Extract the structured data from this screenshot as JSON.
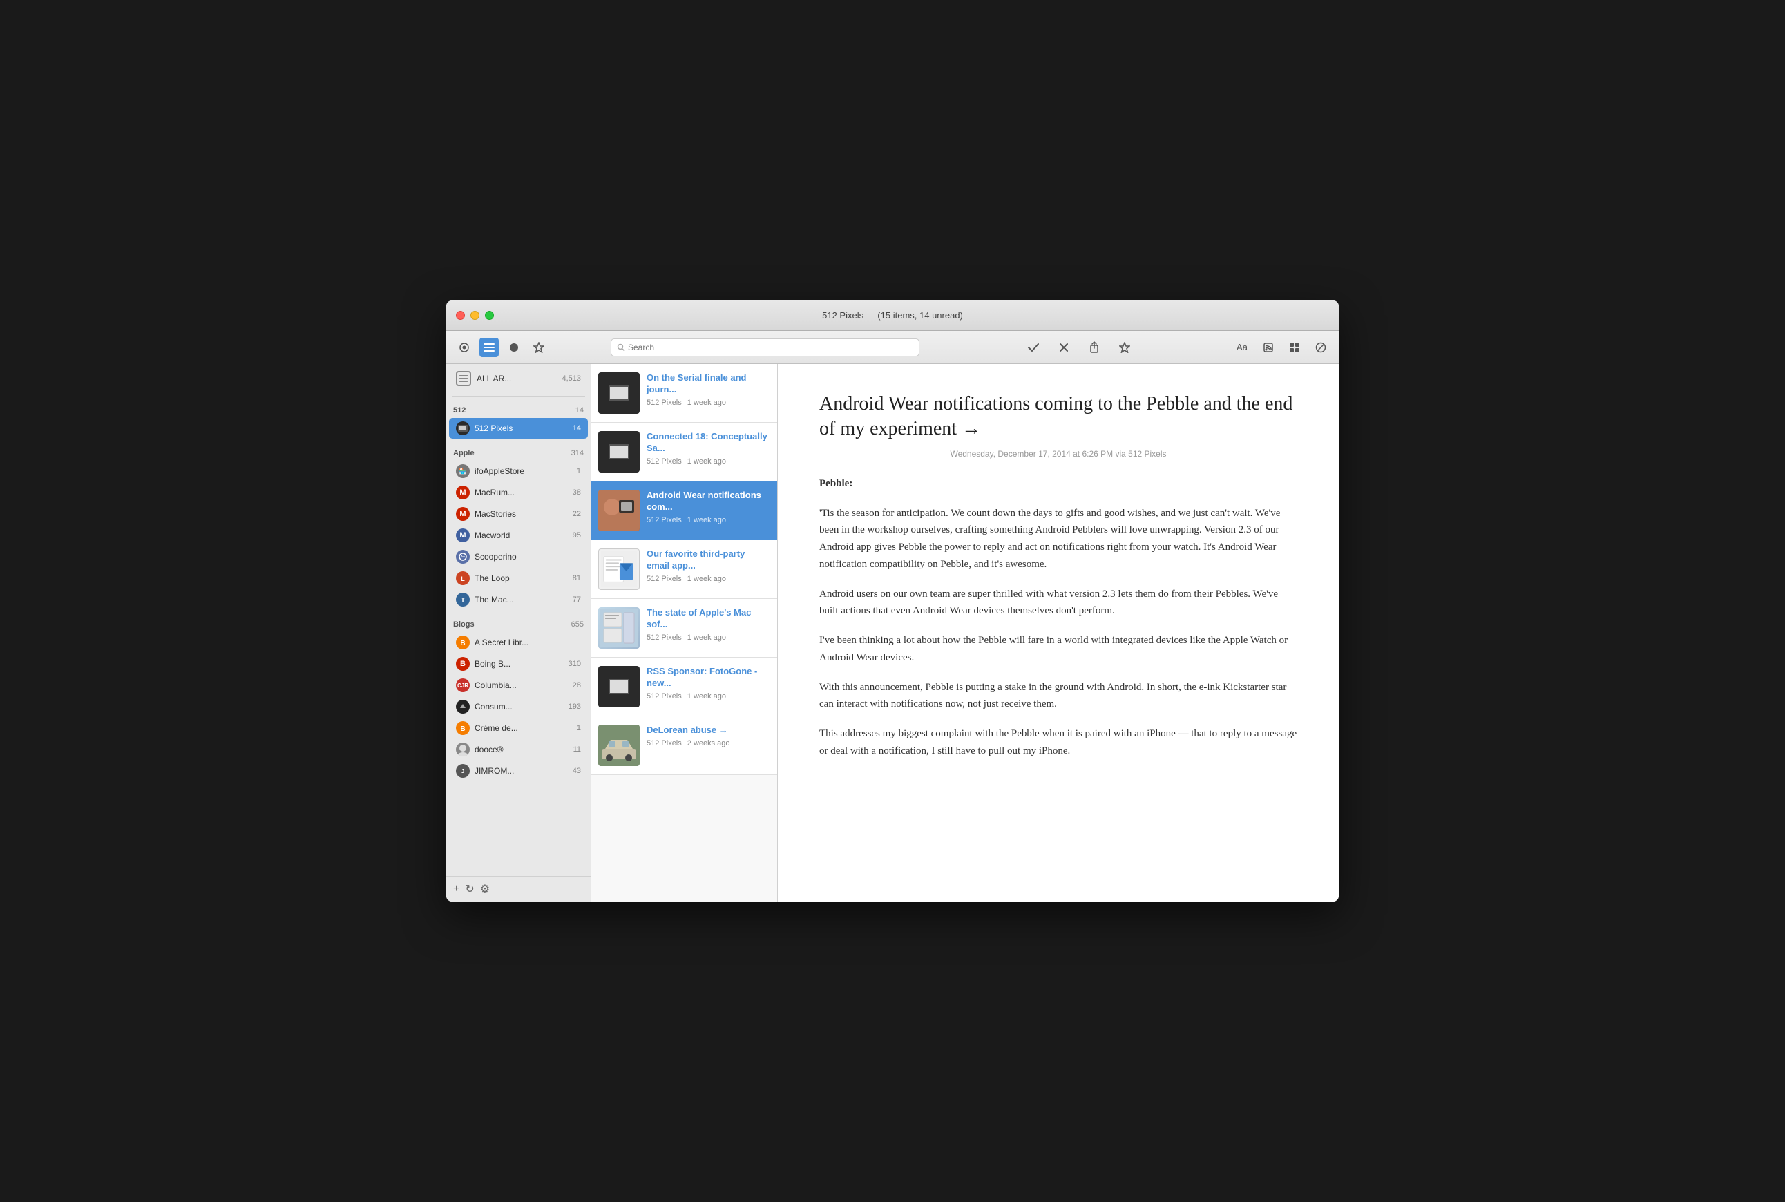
{
  "window": {
    "title": "512 Pixels — (15 items, 14 unread)"
  },
  "toolbar": {
    "search_placeholder": "Search",
    "mark_read_label": "✓",
    "close_label": "✕",
    "share_label": "⬆",
    "star_label": "☆",
    "font_label": "Aa",
    "rss_label": "RSS",
    "list_label": "≡",
    "block_label": "⊘"
  },
  "sidebar": {
    "all_articles_label": "ALL AR...",
    "all_articles_count": "4,513",
    "sections": [
      {
        "id": "512",
        "label": "512",
        "count": "14",
        "feeds": [
          {
            "id": "512pixels",
            "label": "512 Pixels",
            "count": "14",
            "active": true
          }
        ]
      },
      {
        "id": "apple",
        "label": "Apple",
        "count": "314",
        "feeds": [
          {
            "id": "ifoAppleStore",
            "label": "ifoAppleStore",
            "count": "1",
            "icon_color": "#888",
            "icon_char": "🏪"
          },
          {
            "id": "macrumors",
            "label": "MacRum...",
            "count": "38",
            "icon_color": "#cc2200",
            "icon_char": "M"
          },
          {
            "id": "macstories",
            "label": "MacStories",
            "count": "22",
            "icon_color": "#cc2200",
            "icon_char": "M"
          },
          {
            "id": "macworld",
            "label": "Macworld",
            "count": "95",
            "icon_color": "#4060a0",
            "icon_char": "M"
          },
          {
            "id": "scoopbox",
            "label": "Scooperino",
            "count": "",
            "icon_color": "#5a70a8",
            "icon_char": "S"
          },
          {
            "id": "theloop",
            "label": "The Loop",
            "count": "81",
            "icon_color": "#cc4422",
            "icon_char": "L"
          },
          {
            "id": "themac",
            "label": "The Mac...",
            "count": "77",
            "icon_color": "#336699",
            "icon_char": "T"
          }
        ]
      },
      {
        "id": "blogs",
        "label": "Blogs",
        "count": "655",
        "feeds": [
          {
            "id": "asecretlibr",
            "label": "A Secret Libr...",
            "count": "",
            "icon_color": "#f57d00",
            "icon_char": "B"
          },
          {
            "id": "boingb",
            "label": "Boing B...",
            "count": "310",
            "icon_color": "#cc2200",
            "icon_char": "B"
          },
          {
            "id": "columbia",
            "label": "Columbia...",
            "count": "28",
            "icon_color": "#c8302a",
            "icon_char": "CJR"
          },
          {
            "id": "consum",
            "label": "Consum...",
            "count": "193",
            "icon_color": "#222",
            "icon_char": "C"
          },
          {
            "id": "cremede",
            "label": "Crème de...",
            "count": "1",
            "icon_color": "#f57d00",
            "icon_char": "B"
          },
          {
            "id": "dooce",
            "label": "dooce®",
            "count": "11",
            "icon_color": "#888",
            "icon_char": "d"
          },
          {
            "id": "jimrom",
            "label": "JIMROM...",
            "count": "43",
            "icon_color": "#555",
            "icon_char": "J"
          }
        ]
      }
    ],
    "bottom_buttons": [
      {
        "id": "add",
        "label": "+"
      },
      {
        "id": "refresh",
        "label": "↻"
      },
      {
        "id": "settings",
        "label": "⚙"
      }
    ]
  },
  "article_list": {
    "items": [
      {
        "id": "1",
        "title": "On the Serial finale and journ...",
        "source": "512 Pixels",
        "time": "1 week ago",
        "thumb_type": "pebble",
        "active": false
      },
      {
        "id": "2",
        "title": "Connected 18: Conceptually Sa...",
        "source": "512 Pixels",
        "time": "1 week ago",
        "thumb_type": "pebble",
        "active": false
      },
      {
        "id": "3",
        "title": "Android Wear notifications com...",
        "source": "512 Pixels",
        "time": "1 week ago",
        "thumb_type": "watch",
        "active": true
      },
      {
        "id": "4",
        "title": "Our favorite third-party email app...",
        "source": "512 Pixels",
        "time": "1 week ago",
        "thumb_type": "email",
        "active": false
      },
      {
        "id": "5",
        "title": "The state of Apple's Mac sof...",
        "source": "512 Pixels",
        "time": "1 week ago",
        "thumb_type": "mac",
        "active": false
      },
      {
        "id": "6",
        "title": "RSS Sponsor: FotoGone - new...",
        "source": "512 Pixels",
        "time": "1 week ago",
        "thumb_type": "pebble",
        "active": false
      },
      {
        "id": "7",
        "title": "DeLorean abuse →",
        "source": "512 Pixels",
        "time": "2 weeks ago",
        "thumb_type": "car",
        "active": false
      }
    ]
  },
  "reading_pane": {
    "title": "Android Wear notifications coming to the Pebble and the end of my experiment →",
    "date": "Wednesday, December 17, 2014 at 6:26 PM via 512 Pixels",
    "source_label": "Pebble:",
    "paragraphs": [
      "'Tis the season for anticipation. We count down the days to gifts and good wishes, and we just can't wait. We've been in the workshop ourselves, crafting something Android Pebblers will love unwrapping. Version 2.3 of our Android app gives Pebble the power to reply and act on notifications right from your watch. It's Android Wear notification compatibility on Pebble, and it's awesome.",
      "Android users on our own team are super thrilled with what version 2.3 lets them do from their Pebbles. We've built actions that even Android Wear devices themselves don't perform.",
      "I've been thinking a lot about how the Pebble will fare in a world with integrated devices like the Apple Watch or Android Wear devices.",
      "With this announcement, Pebble is putting a stake in the ground with Android. In short, the e-ink Kickstarter star can interact with notifications now, not just receive them.",
      "This addresses my biggest complaint with the Pebble when it is paired with an iPhone — that to reply to a message or deal with a notification, I still have to pull out my iPhone."
    ]
  }
}
